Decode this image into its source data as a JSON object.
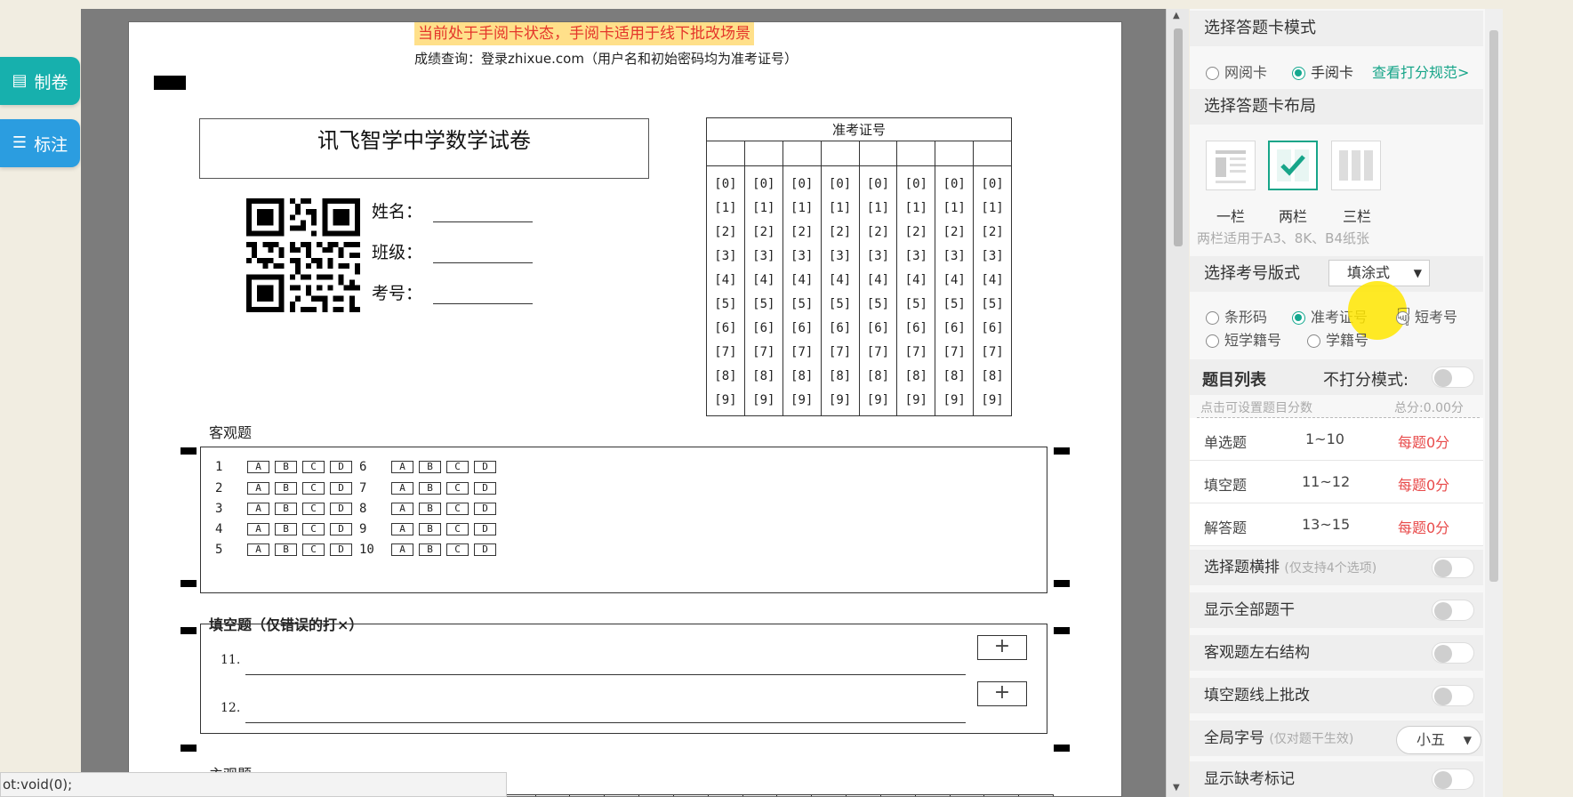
{
  "left_buttons": {
    "make_label": "制卷",
    "annotate_label": "标注"
  },
  "paper": {
    "notice": "当前处于手阅卡状态，手阅卡适用于线下批改场景",
    "score_query": "成绩查询：登录zhixue.com（用户名和初始密码均为准考证号）",
    "exam_title": "讯飞智学中学数学试卷",
    "info_labels": {
      "name": "姓名：",
      "class": "班级：",
      "exam_no": "考号："
    },
    "admission": {
      "title": "准考证号",
      "digits": [
        "[0]",
        "[1]",
        "[2]",
        "[3]",
        "[4]",
        "[5]",
        "[6]",
        "[7]",
        "[8]",
        "[9]"
      ]
    },
    "objective": {
      "label": "客观题",
      "options": [
        "A",
        "B",
        "C",
        "D"
      ],
      "left_nums": [
        "1",
        "2",
        "3",
        "4",
        "5"
      ],
      "right_nums": [
        "6",
        "7",
        "8",
        "9",
        "10"
      ]
    },
    "fill": {
      "label": "填空题（仅错误的打×）",
      "items": [
        "11.",
        "12."
      ],
      "plus": "+"
    },
    "essay_label": "主观题"
  },
  "panel": {
    "mode_header": "选择答题卡模式",
    "mode_online": "网阅卡",
    "mode_manual": "手阅卡",
    "scoring_link": "查看打分规范>",
    "layout_header": "选择答题卡布局",
    "layout_one": "一栏",
    "layout_two": "两栏",
    "layout_three": "三栏",
    "layout_note": "两栏适用于A3、8K、B4纸张",
    "exam_no_header": "选择考号版式",
    "exam_no_style": "填涂式",
    "id_barcode": "条形码",
    "id_admission": "准考证号",
    "id_short_exam": "短考号",
    "id_short_student": "短学籍号",
    "id_student": "学籍号",
    "question_list": "题目列表",
    "no_score_mode": "不打分模式:",
    "click_hint": "点击可设置题目分数",
    "total": "总分:0.00分",
    "rows": [
      {
        "type": "单选题",
        "range": "1~10",
        "score": "每题0分"
      },
      {
        "type": "填空题",
        "range": "11~12",
        "score": "每题0分"
      },
      {
        "type": "解答题",
        "range": "13~15",
        "score": "每题0分"
      }
    ],
    "settings": {
      "choice_horizontal": "选择题横排",
      "choice_horizontal_hint": "(仅支持4个选项)",
      "show_all_stems": "显示全部题干",
      "objective_lr": "客观题左右结构",
      "fill_online": "填空题线上批改",
      "global_font": "全局字号",
      "global_font_hint": "(仅对题干生效)",
      "font_size": "小五",
      "show_absent": "显示缺考标记"
    }
  },
  "status_bar": "ot:void(0);",
  "colors": {
    "accent": "#17a589",
    "left_btn_teal": "#17b0ad",
    "left_btn_blue": "#2b9de0",
    "notice_bg": "#ffe08a",
    "notice_text": "#e4352a",
    "score_red": "#e84a4a"
  }
}
